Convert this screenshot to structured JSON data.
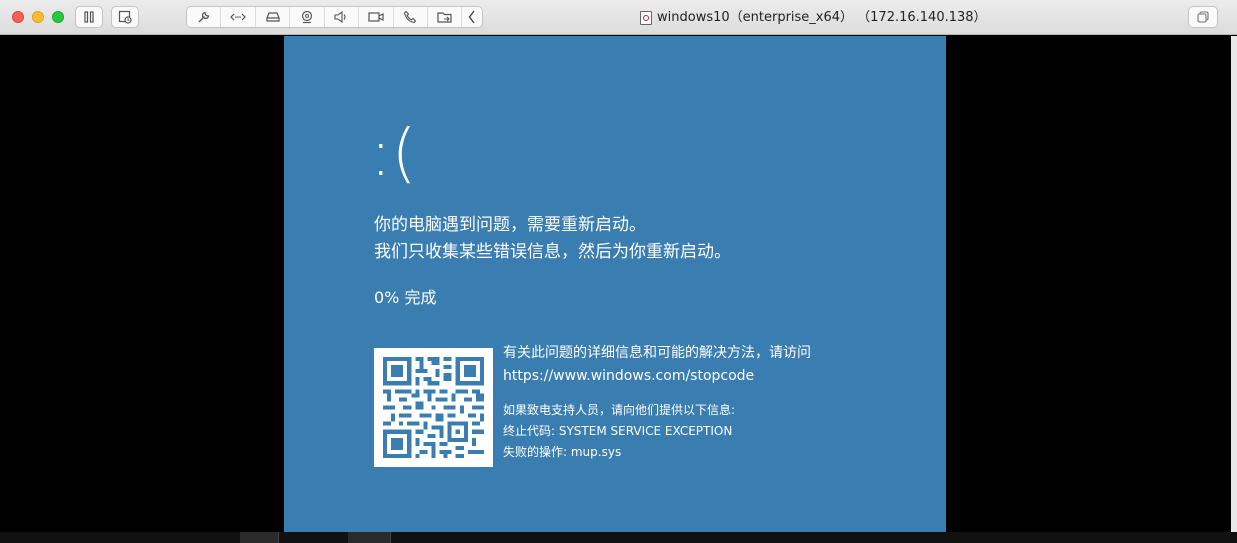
{
  "window": {
    "title": "windows10（enterprise_x64） （172.16.140.138）"
  },
  "toolbar": {
    "icons": [
      "pause-icon",
      "snapshot-icon",
      "settings-wrench-icon",
      "network-icon",
      "disk-icon",
      "camera-icon",
      "sound-icon",
      "video-icon",
      "phone-icon",
      "shared-folder-icon",
      "chevron-left-icon"
    ],
    "right_icon": "fullscreen-icon"
  },
  "bsod": {
    "face": ":(",
    "line1": "你的电脑遇到问题，需要重新启动。",
    "line2": "我们只收集某些错误信息，然后为你重新启动。",
    "progress": "0% 完成",
    "info_line": "有关此问题的详细信息和可能的解决方法，请访问",
    "url": "https://www.windows.com/stopcode",
    "support_line": "如果致电支持人员，请向他们提供以下信息:",
    "stop_code": "终止代码: SYSTEM  SERVICE  EXCEPTION",
    "failed_op": "失败的操作: mup.sys"
  },
  "colors": {
    "bsod_bg": "#3a7db1",
    "titlebar_bg": "#e4e4e4"
  }
}
